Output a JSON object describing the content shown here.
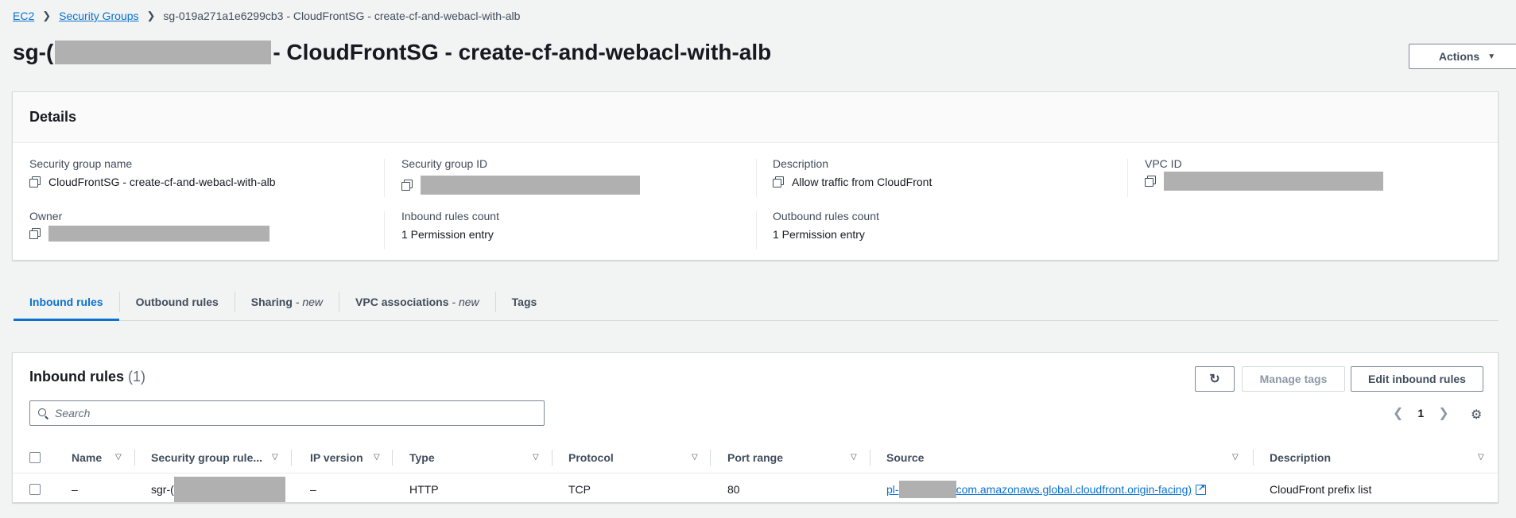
{
  "breadcrumb": {
    "root": "EC2",
    "section": "Security Groups",
    "current": "sg-019a271a1e6299cb3 - CloudFrontSG - create-cf-and-webacl-with-alb"
  },
  "page": {
    "title_prefix": "sg-(",
    "title_suffix": "- CloudFrontSG - create-cf-and-webacl-with-alb",
    "actions_label": "Actions"
  },
  "details": {
    "title": "Details",
    "sg_name_label": "Security group name",
    "sg_name_value": "CloudFrontSG - create-cf-and-webacl-with-alb",
    "sg_id_label": "Security group ID",
    "description_label": "Description",
    "description_value": "Allow traffic from CloudFront",
    "vpc_id_label": "VPC ID",
    "owner_label": "Owner",
    "inbound_count_label": "Inbound rules count",
    "inbound_count_value": "1 Permission entry",
    "outbound_count_label": "Outbound rules count",
    "outbound_count_value": "1 Permission entry"
  },
  "tabs": {
    "inbound": "Inbound rules",
    "outbound": "Outbound rules",
    "sharing": "Sharing",
    "sharing_new": "- new",
    "vpc_assoc": "VPC associations",
    "vpc_assoc_new": "- new",
    "tags": "Tags"
  },
  "rules": {
    "title": "Inbound rules",
    "count": "(1)",
    "manage_tags_label": "Manage tags",
    "edit_label": "Edit inbound rules",
    "search_placeholder": "Search",
    "page_number": "1",
    "columns": {
      "name": "Name",
      "sg_rule": "Security group rule...",
      "ip_version": "IP version",
      "type": "Type",
      "protocol": "Protocol",
      "port_range": "Port range",
      "source": "Source",
      "description": "Description"
    },
    "row": {
      "name": "–",
      "sg_rule_prefix": "sgr-(",
      "ip_version": "–",
      "type": "HTTP",
      "protocol": "TCP",
      "port_range": "80",
      "source_prefix": "pl-",
      "source_suffix": "com.amazonaws.global.cloudfront.origin-facing)",
      "description": "CloudFront prefix list"
    }
  },
  "icons": {
    "copy": "copy-icon",
    "refresh": "refresh-icon",
    "settings": "gear-icon",
    "external": "external-link-icon",
    "search": "search-icon"
  }
}
